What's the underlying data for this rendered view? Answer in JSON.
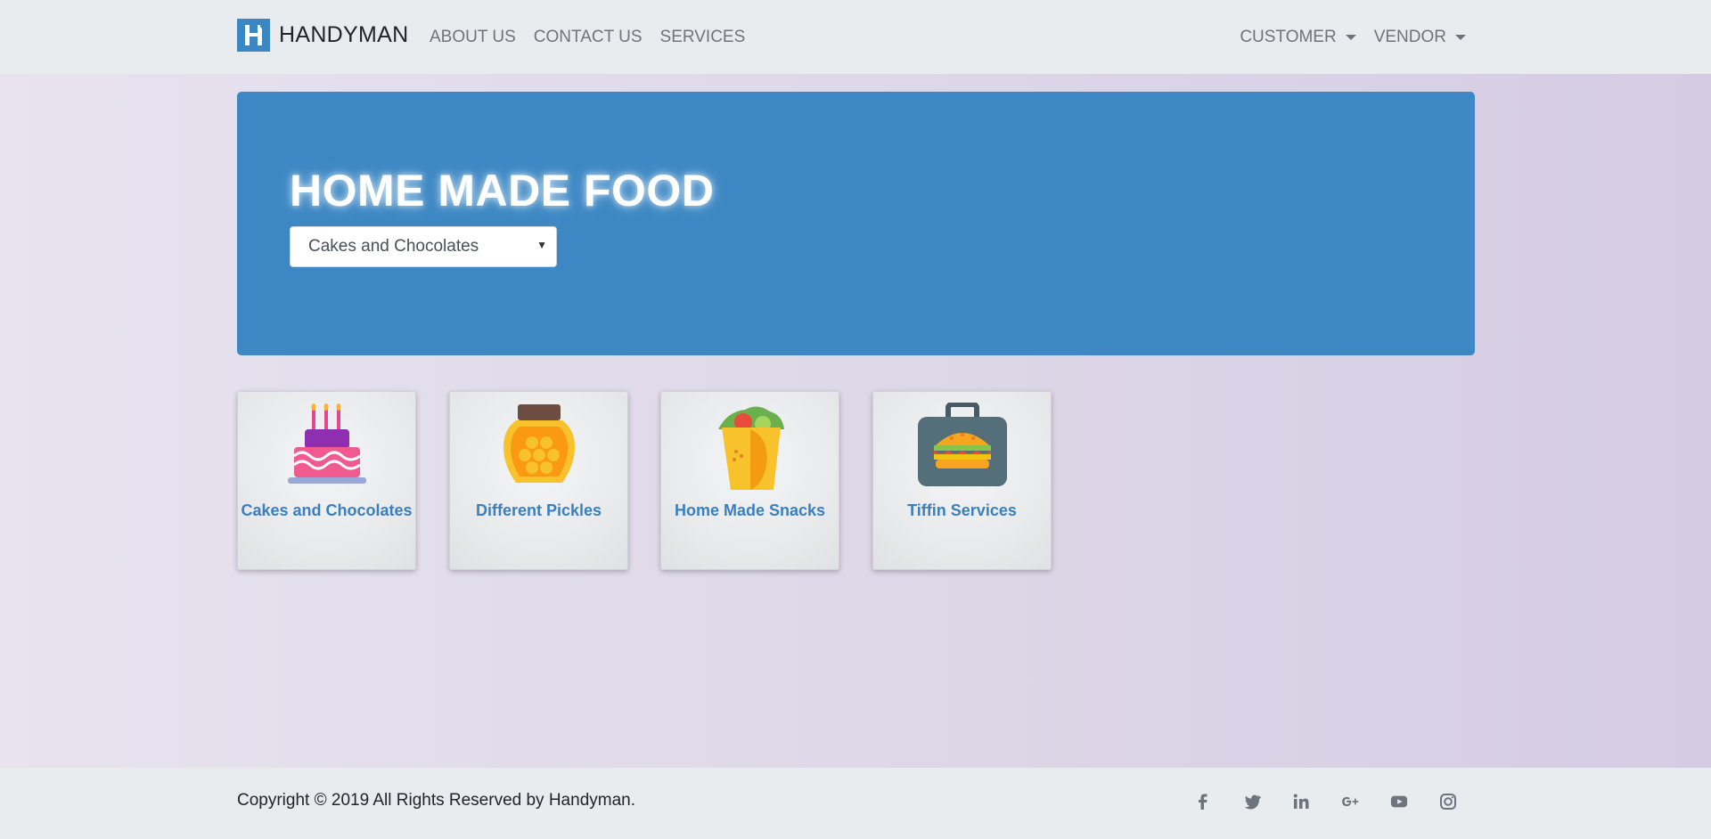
{
  "navbar": {
    "brand": "HANDYMAN",
    "logo_icon": "handyman-logo-icon",
    "links": [
      "ABOUT US",
      "CONTACT US",
      "SERVICES"
    ],
    "dropdowns": [
      "CUSTOMER",
      "VENDOR"
    ]
  },
  "hero": {
    "title": "HOME MADE FOOD",
    "select": {
      "value": "Cakes and Chocolates"
    }
  },
  "categories": [
    {
      "label": "Cakes and Chocolates",
      "icon": "cake-icon"
    },
    {
      "label": "Different Pickles",
      "icon": "honey-jar-icon"
    },
    {
      "label": "Home Made Snacks",
      "icon": "burrito-icon"
    },
    {
      "label": "Tiffin Services",
      "icon": "lunchbox-burger-icon"
    }
  ],
  "footer": {
    "copyright": "Copyright © 2019 All Rights Reserved by Handyman.",
    "social": [
      "facebook-icon",
      "twitter-icon",
      "linkedin-icon",
      "google-plus-icon",
      "youtube-icon",
      "instagram-icon"
    ]
  },
  "colors": {
    "primary": "#3d88c4",
    "link": "#3a7fc0",
    "navbar_bg": "#e9ecef"
  }
}
